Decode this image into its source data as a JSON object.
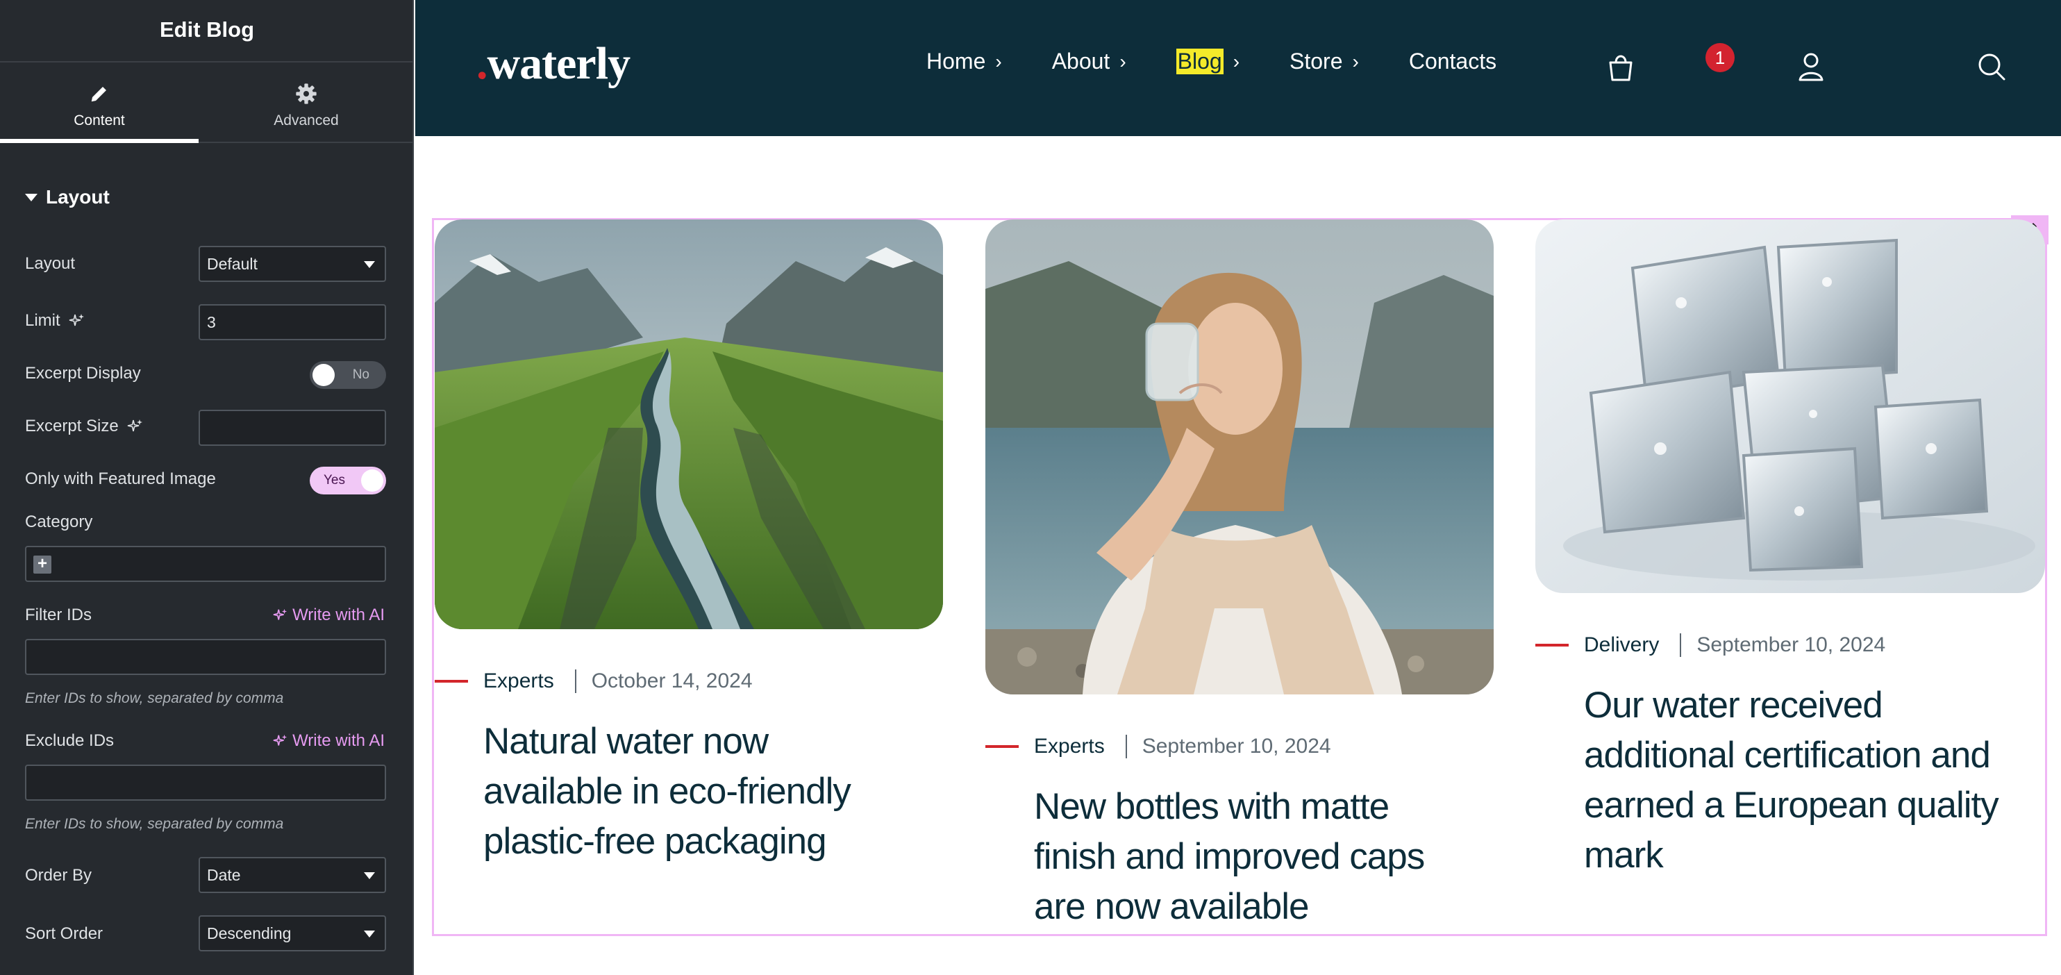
{
  "panel": {
    "title": "Edit Blog",
    "tabs": [
      {
        "label": "Content",
        "icon": "pencil-icon",
        "active": true
      },
      {
        "label": "Advanced",
        "icon": "gear-icon",
        "active": false
      }
    ],
    "section_title": "Layout",
    "fields": {
      "layout": {
        "label": "Layout",
        "value": "Default"
      },
      "limit": {
        "label": "Limit",
        "value": "3"
      },
      "excerpt_display": {
        "label": "Excerpt Display",
        "toggle": "No"
      },
      "excerpt_size": {
        "label": "Excerpt Size",
        "value": ""
      },
      "only_featured": {
        "label": "Only with Featured Image",
        "toggle": "Yes"
      },
      "category": {
        "label": "Category"
      },
      "filter_ids": {
        "label": "Filter IDs",
        "ai_label": "Write with AI",
        "value": "",
        "hint": "Enter IDs to show, separated by comma"
      },
      "exclude_ids": {
        "label": "Exclude IDs",
        "ai_label": "Write with AI",
        "value": "",
        "hint": "Enter IDs to show, separated by comma"
      },
      "order_by": {
        "label": "Order By",
        "value": "Date"
      },
      "sort_order": {
        "label": "Sort Order",
        "value": "Descending"
      }
    }
  },
  "site": {
    "logo": {
      "dot": ".",
      "text": "waterly"
    },
    "nav": [
      {
        "label": "Home",
        "chevron": "›"
      },
      {
        "label": "About",
        "chevron": "›"
      },
      {
        "label": "Blog",
        "chevron": "›",
        "highlighted": true
      },
      {
        "label": "Store",
        "chevron": "›"
      },
      {
        "label": "Contacts"
      }
    ],
    "cart_count": "1",
    "icons": [
      "user-icon",
      "cart-icon",
      "search-icon"
    ]
  },
  "posts": [
    {
      "category": "Experts",
      "date": "October 14, 2024",
      "title_lines": [
        "Natural water now",
        "available in eco-friendly",
        "plastic-free packaging"
      ],
      "image": "mountain-valley-river"
    },
    {
      "category": "Experts",
      "date": "September 10, 2024",
      "title_lines": [
        "New bottles with matte",
        "finish and improved caps",
        "are now available"
      ],
      "image": "woman-drinking-water-by-lake"
    },
    {
      "category": "Delivery",
      "date": "September 10, 2024",
      "title_lines": [
        "Our water received",
        "additional certification and",
        "earned a European quality",
        "mark"
      ],
      "image": "ice-cubes"
    }
  ],
  "colors": {
    "panel_bg": "#262a2f",
    "header_bg": "#0d2d3a",
    "accent_red": "#d3262b",
    "highlight": "#f4ea2a",
    "widget_outline": "#f0b6f5",
    "ai_pink": "#e69bf1"
  }
}
